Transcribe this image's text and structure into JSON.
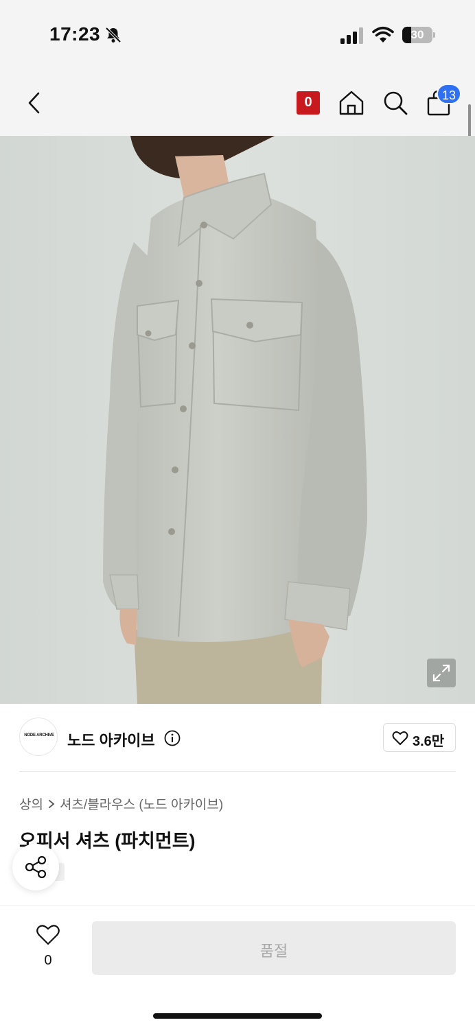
{
  "status_bar": {
    "time": "17:23",
    "battery_level": "30",
    "battery_fraction": 0.3,
    "icons": [
      "bell-slash-icon",
      "signal-icon",
      "wifi-icon",
      "battery-icon"
    ]
  },
  "nav": {
    "store_badge": "0",
    "cart_count": "13",
    "icons": [
      "chevron-left-icon",
      "home-icon",
      "search-icon",
      "shopping-bag-icon"
    ]
  },
  "product_image": {
    "alt": "오피서 셔츠 (파치먼트)",
    "icons": [
      "expand-icon"
    ]
  },
  "brand": {
    "logo_text": "NODE ARCHIVE",
    "name": "노드 아카이브",
    "like_count": "3.6만",
    "icons": [
      "info-icon",
      "heart-outline-icon"
    ]
  },
  "breadcrumb": {
    "category": "상의",
    "subcategory": "셔츠/블라우스 (노드 아카이브)"
  },
  "product": {
    "title": "오피서 셔츠 (파치먼트)"
  },
  "floating": {
    "icons": [
      "share-icon"
    ]
  },
  "bottom_bar": {
    "wish_count": "0",
    "soldout_label": "품절",
    "icons": [
      "heart-outline-icon"
    ]
  },
  "colors": {
    "store_badge": "#c8191f",
    "cart_badge": "#2f6ff2",
    "header_bg": "#f4f4f4",
    "soldout_bg": "#ebebeb",
    "shirt": "#c8cbc3",
    "pants": "#bdb49c"
  }
}
